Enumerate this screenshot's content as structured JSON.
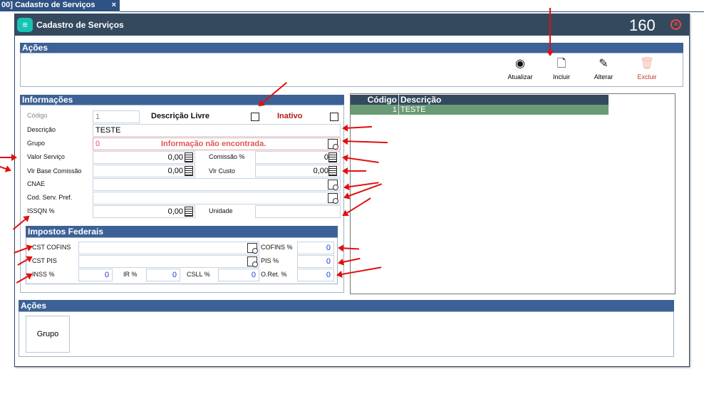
{
  "tab": {
    "label": "00] Cadastro de Serviços",
    "close": "×"
  },
  "window": {
    "title": "Cadastro de Serviços",
    "code": "160",
    "close": "×"
  },
  "actions_top": {
    "heading": "Ações",
    "buttons": [
      {
        "label": "Atualizar",
        "icon": "refresh-icon"
      },
      {
        "label": "Incluir",
        "icon": "new-document-icon"
      },
      {
        "label": "Alterar",
        "icon": "edit-icon"
      },
      {
        "label": "Excluir",
        "icon": "trash-icon"
      }
    ]
  },
  "info": {
    "heading": "Informações",
    "codigo": {
      "label": "Código",
      "value": "1"
    },
    "descricao_livre": {
      "label": "Descrição Livre",
      "checked": false
    },
    "inativo": {
      "label": "Inativo",
      "checked": false
    },
    "descricao": {
      "label": "Descrição",
      "value": "TESTE"
    },
    "grupo": {
      "label": "Grupo",
      "value": "0",
      "error": "Informação não encontrada."
    },
    "valor_servico": {
      "label": "Valor Serviço",
      "value": "0,00"
    },
    "comissao": {
      "label": "Comissão %",
      "value": "0"
    },
    "vlr_base_comissao": {
      "label": "Vlr Base Comissão",
      "value": "0,00"
    },
    "vlr_custo": {
      "label": "Vlr Custo",
      "value": "0,00"
    },
    "cnae": {
      "label": "CNAE",
      "value": ""
    },
    "cod_serv_pref": {
      "label": "Cod. Serv. Pref.",
      "value": ""
    },
    "issqn": {
      "label": "ISSQN %",
      "value": "0,00"
    },
    "unidade": {
      "label": "Unidade",
      "value": ""
    }
  },
  "impostos": {
    "heading": "Impostos Federais",
    "cst_cofins": {
      "label": "CST COFINS",
      "value": ""
    },
    "cofins": {
      "label": "COFINS %",
      "value": "0"
    },
    "cst_pis": {
      "label": "CST PIS",
      "value": ""
    },
    "pis": {
      "label": "PIS %",
      "value": "0"
    },
    "inss": {
      "label": "INSS %",
      "value": "0"
    },
    "ir": {
      "label": "IR %",
      "value": "0"
    },
    "csll": {
      "label": "CSLL %",
      "value": "0"
    },
    "oret": {
      "label": "O.Ret. %",
      "value": "0"
    }
  },
  "grid": {
    "columns": [
      "Código",
      "Descrição"
    ],
    "rows": [
      [
        "1",
        "TESTE"
      ]
    ]
  },
  "actions_bottom": {
    "heading": "Ações",
    "buttons": [
      {
        "label": "Grupo"
      }
    ]
  },
  "colors": {
    "header": "#3c6196",
    "titlebar": "#34495e",
    "selected_row": "#6b9b75",
    "error": "#e05555",
    "annotation": "#e01010"
  }
}
